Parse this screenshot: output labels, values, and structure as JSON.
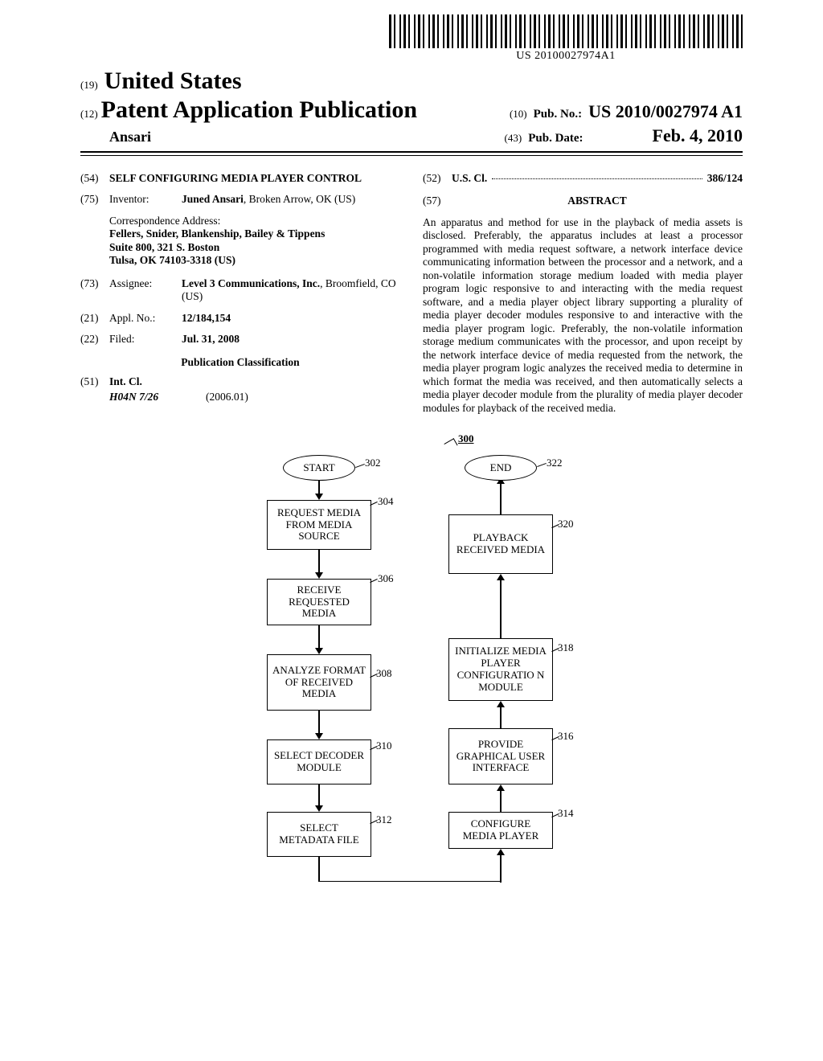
{
  "barcode_text": "US 20100027974A1",
  "header": {
    "code19": "(19)",
    "country": "United States",
    "code12": "(12)",
    "pub_type": "Patent Application Publication",
    "inventor_lastname": "Ansari",
    "code10": "(10)",
    "pub_no_label": "Pub. No.:",
    "pub_no": "US 2010/0027974 A1",
    "code43": "(43)",
    "pub_date_label": "Pub. Date:",
    "pub_date": "Feb. 4, 2010"
  },
  "fields": {
    "c54": "(54)",
    "title": "SELF CONFIGURING MEDIA PLAYER CONTROL",
    "c75": "(75)",
    "inventor_label": "Inventor:",
    "inventor_value": "Juned Ansari",
    "inventor_loc": ", Broken Arrow, OK (US)",
    "corr_label": "Correspondence Address:",
    "corr_name": "Fellers, Snider, Blankenship, Bailey & Tippens",
    "corr_addr1": "Suite 800, 321 S. Boston",
    "corr_addr2": "Tulsa, OK 74103-3318 (US)",
    "c73": "(73)",
    "assignee_label": "Assignee:",
    "assignee_value": "Level 3 Communications, Inc.",
    "assignee_loc": ", Broomfield, CO (US)",
    "c21": "(21)",
    "appl_label": "Appl. No.:",
    "appl_no": "12/184,154",
    "c22": "(22)",
    "filed_label": "Filed:",
    "filed_date": "Jul. 31, 2008",
    "pub_class_heading": "Publication Classification",
    "c51": "(51)",
    "intcl_label": "Int. Cl.",
    "intcl_code": "H04N 7/26",
    "intcl_date": "(2006.01)",
    "c52": "(52)",
    "uscl_label": "U.S. Cl.",
    "uscl_value": "386/124",
    "c57": "(57)",
    "abstract_heading": "ABSTRACT",
    "abstract_text": "An apparatus and method for use in the playback of media assets is disclosed. Preferably, the apparatus includes at least a processor programmed with media request software, a network interface device communicating information between the processor and a network, and a non-volatile information storage medium loaded with media player program logic responsive to and interacting with the media request software, and a media player object library supporting a plurality of media player decoder modules responsive to and interactive with the media player program logic. Preferably, the non-volatile information storage medium communicates with the processor, and upon receipt by the network interface device of media requested from the network, the media player program logic analyzes the received media to determine in which format the media was received, and then automatically selects a media player decoder module from the plurality of media player decoder modules for playback of the received media."
  },
  "flowchart": {
    "ref_main": "300",
    "start": "START",
    "end": "END",
    "r302": "302",
    "r304": "304",
    "r306": "306",
    "r308": "308",
    "r310": "310",
    "r312": "312",
    "r314": "314",
    "r316": "316",
    "r318": "318",
    "r320": "320",
    "r322": "322",
    "box304": "REQUEST MEDIA FROM MEDIA SOURCE",
    "box306": "RECEIVE REQUESTED MEDIA",
    "box308": "ANALYZE FORMAT OF RECEIVED MEDIA",
    "box310": "SELECT DECODER MODULE",
    "box312": "SELECT METADATA FILE",
    "box314": "CONFIGURE MEDIA PLAYER",
    "box316": "PROVIDE GRAPHICAL USER INTERFACE",
    "box318": "INITIALIZE MEDIA PLAYER CONFIGURATIO N MODULE",
    "box320": "PLAYBACK RECEIVED MEDIA"
  }
}
